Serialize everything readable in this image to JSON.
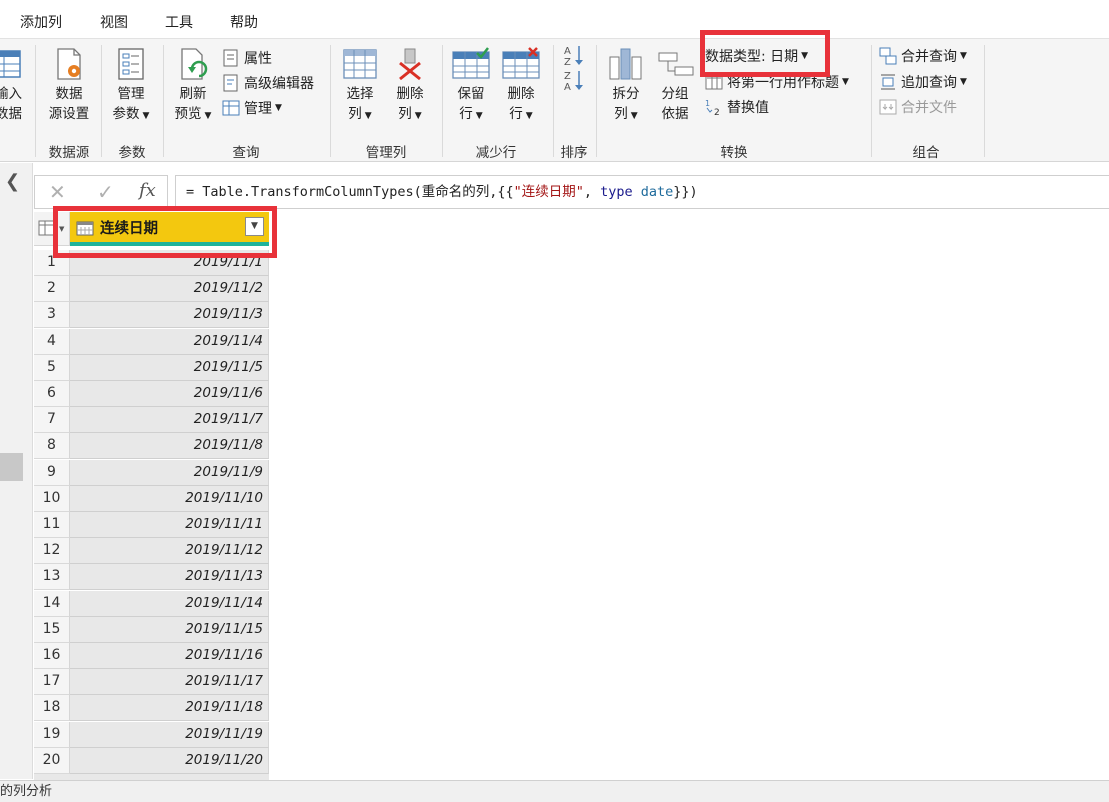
{
  "menu": {
    "tabs": [
      "添加列",
      "视图",
      "工具",
      "帮助"
    ]
  },
  "ribbon": {
    "partial_left": {
      "line1": "输入",
      "line2": "数据"
    },
    "groups": {
      "datasource": {
        "label": "数据源",
        "button": {
          "line1": "数据",
          "line2": "源设置"
        }
      },
      "params": {
        "label": "参数",
        "button": {
          "line1": "管理",
          "line2": "参数"
        }
      },
      "query": {
        "label": "查询",
        "refresh": {
          "line1": "刷新",
          "line2": "预览"
        },
        "properties": "属性",
        "advanced_editor": "高级编辑器",
        "manage": "管理"
      },
      "manage_cols": {
        "label": "管理列",
        "choose": {
          "line1": "选择",
          "line2": "列"
        },
        "remove": {
          "line1": "删除",
          "line2": "列"
        }
      },
      "reduce_rows": {
        "label": "减少行",
        "keep": {
          "line1": "保留",
          "line2": "行"
        },
        "remove": {
          "line1": "删除",
          "line2": "行"
        }
      },
      "sort": {
        "label": "排序"
      },
      "transform": {
        "label": "转换",
        "split": {
          "line1": "拆分",
          "line2": "列"
        },
        "group": {
          "line1": "分组",
          "line2": "依据"
        },
        "data_type": "数据类型: 日期",
        "first_row_header": "将第一行用作标题",
        "replace_values": "替换值"
      },
      "combine": {
        "label": "组合",
        "merge": "合并查询",
        "append": "追加查询",
        "combine_files": "合并文件"
      }
    }
  },
  "formula": {
    "prefix": "= Table.TransformColumnTypes(重命名的列,{{",
    "col_string": "\"连续日期\"",
    "comma": ", ",
    "type_kw": "type",
    "space": " ",
    "type_name": "date",
    "suffix": "}})"
  },
  "grid": {
    "column_name": "连续日期",
    "rows": [
      {
        "n": "1",
        "v": "2019/11/1"
      },
      {
        "n": "2",
        "v": "2019/11/2"
      },
      {
        "n": "3",
        "v": "2019/11/3"
      },
      {
        "n": "4",
        "v": "2019/11/4"
      },
      {
        "n": "5",
        "v": "2019/11/5"
      },
      {
        "n": "6",
        "v": "2019/11/6"
      },
      {
        "n": "7",
        "v": "2019/11/7"
      },
      {
        "n": "8",
        "v": "2019/11/8"
      },
      {
        "n": "9",
        "v": "2019/11/9"
      },
      {
        "n": "10",
        "v": "2019/11/10"
      },
      {
        "n": "11",
        "v": "2019/11/11"
      },
      {
        "n": "12",
        "v": "2019/11/12"
      },
      {
        "n": "13",
        "v": "2019/11/13"
      },
      {
        "n": "14",
        "v": "2019/11/14"
      },
      {
        "n": "15",
        "v": "2019/11/15"
      },
      {
        "n": "16",
        "v": "2019/11/16"
      },
      {
        "n": "17",
        "v": "2019/11/17"
      },
      {
        "n": "18",
        "v": "2019/11/18"
      },
      {
        "n": "19",
        "v": "2019/11/19"
      },
      {
        "n": "20",
        "v": "2019/11/20"
      }
    ]
  },
  "status": {
    "text": "的列分析"
  },
  "colors": {
    "header_yellow": "#f3c80f",
    "header_underline": "#1fb39b",
    "highlight_red": "#e8323a"
  }
}
